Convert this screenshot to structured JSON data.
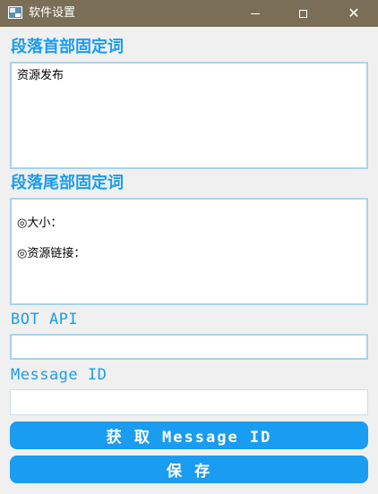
{
  "window": {
    "title": "软件设置",
    "controls": {
      "minimize": "—",
      "maximize": "",
      "close": "✕"
    }
  },
  "form": {
    "header_words": {
      "label": "段落首部固定词",
      "value": "资源发布"
    },
    "footer_words": {
      "label": "段落尾部固定词",
      "lines": [
        "◎大小：",
        "◎资源链接："
      ]
    },
    "bot_api": {
      "label": "BOT API",
      "value": ""
    },
    "message_id": {
      "label": "Message ID",
      "value": ""
    },
    "get_message_id_button": "获 取 Message ID",
    "save_button": "保 存"
  },
  "colors": {
    "titlebar": "#7a6e57",
    "accent": "#1a9cf0",
    "field_border": "#a9d3e6",
    "background": "#f0f0f0"
  }
}
